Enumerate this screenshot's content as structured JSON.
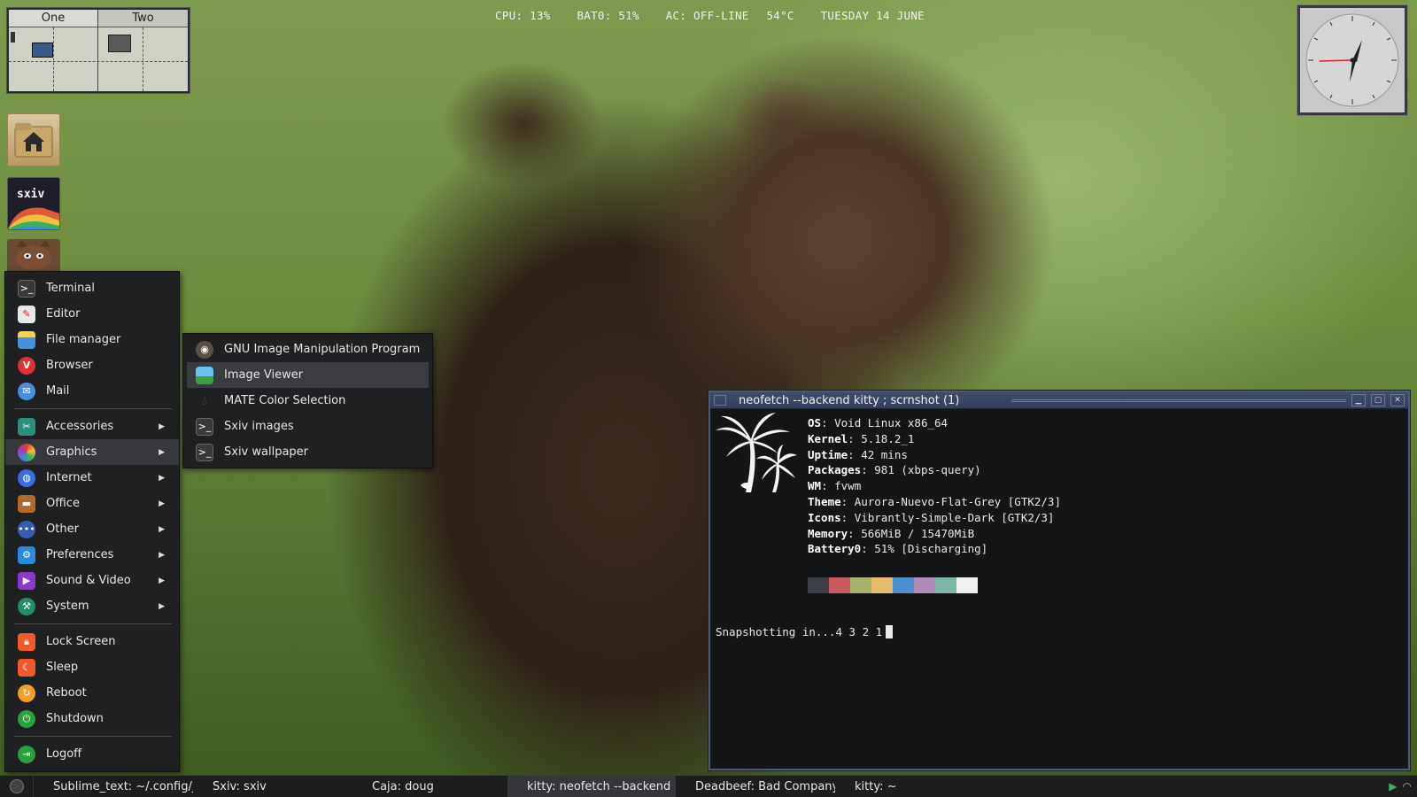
{
  "status_bar": {
    "cpu": "CPU: 13%",
    "battery": "BAT0: 51%",
    "ac": "AC: OFF-LINE",
    "temp": "54°C",
    "date": "TUESDAY 14 JUNE"
  },
  "pager": {
    "desks": [
      "One",
      "Two"
    ]
  },
  "desktop_icons": [
    {
      "name": "home-folder-icon"
    },
    {
      "name": "sxiv-icon"
    },
    {
      "name": "cat-icon"
    }
  ],
  "menu": {
    "items": [
      {
        "label": "Terminal",
        "icon": "terminal-icon",
        "color": "#3a3a3a"
      },
      {
        "label": "Editor",
        "icon": "editor-icon",
        "color": "#d8d8d8"
      },
      {
        "label": "File manager",
        "icon": "file-manager-icon",
        "color": "#4a90d9"
      },
      {
        "label": "Browser",
        "icon": "browser-icon",
        "color": "#e0303a"
      },
      {
        "label": "Mail",
        "icon": "mail-icon",
        "color": "#4a8ee0"
      }
    ],
    "categories": [
      {
        "label": "Accessories",
        "icon": "accessories-icon",
        "color": "#2f8f7f"
      },
      {
        "label": "Graphics",
        "icon": "graphics-icon",
        "color": "#e07a3a"
      },
      {
        "label": "Internet",
        "icon": "internet-icon",
        "color": "#3a6ee0"
      },
      {
        "label": "Office",
        "icon": "office-icon",
        "color": "#b06a30"
      },
      {
        "label": "Other",
        "icon": "other-icon",
        "color": "#3a5ab0"
      },
      {
        "label": "Preferences",
        "icon": "preferences-icon",
        "color": "#2a8ae0"
      },
      {
        "label": "Sound & Video",
        "icon": "sound-video-icon",
        "color": "#8a3ac0"
      },
      {
        "label": "System",
        "icon": "system-icon",
        "color": "#2a8a6a"
      }
    ],
    "session": [
      {
        "label": "Lock Screen",
        "icon": "lock-icon",
        "color": "#f05a2a"
      },
      {
        "label": "Sleep",
        "icon": "sleep-icon",
        "color": "#f05a2a"
      },
      {
        "label": "Reboot",
        "icon": "reboot-icon",
        "color": "#f0a02a"
      },
      {
        "label": "Shutdown",
        "icon": "shutdown-icon",
        "color": "#2aa040"
      }
    ],
    "logoff": {
      "label": "Logoff",
      "icon": "logoff-icon",
      "color": "#2aa040"
    }
  },
  "submenu": {
    "items": [
      {
        "label": "GNU Image Manipulation Program",
        "icon": "gimp-icon"
      },
      {
        "label": "Image Viewer",
        "icon": "image-viewer-icon"
      },
      {
        "label": "MATE Color Selection",
        "icon": "color-selection-icon"
      },
      {
        "label": "Sxiv images",
        "icon": "terminal-icon"
      },
      {
        "label": "Sxiv wallpaper",
        "icon": "terminal-icon"
      }
    ]
  },
  "terminal": {
    "title": "neofetch --backend kitty ; scrnshot (1)",
    "info": [
      {
        "key": "OS",
        "value": ": Void Linux x86_64"
      },
      {
        "key": "Kernel",
        "value": ": 5.18.2_1"
      },
      {
        "key": "Uptime",
        "value": ": 42 mins"
      },
      {
        "key": "Packages",
        "value": ": 981 (xbps-query)"
      },
      {
        "key": "WM",
        "value": ": fvwm"
      },
      {
        "key": "Theme",
        "value": ": Aurora-Nuevo-Flat-Grey [GTK2/3]"
      },
      {
        "key": "Icons",
        "value": ": Vibrantly-Simple-Dark [GTK2/3]"
      },
      {
        "key": "Memory",
        "value": ": 566MiB / 15470MiB"
      },
      {
        "key": "Battery0",
        "value": ": 51% [Discharging]"
      }
    ],
    "swatches": [
      "#3b3e45",
      "#c95a5e",
      "#a7b36a",
      "#e6bd6a",
      "#4d8fce",
      "#b48ab6",
      "#7fb7a8",
      "#f0f0f0"
    ],
    "snapshot": "Snapshotting in...4 3 2 1"
  },
  "taskbar": {
    "tasks": [
      "Sublime_text: ~/.config/jg",
      "Sxiv: sxiv",
      "Caja: doug",
      "kitty: neofetch --backend",
      "Deadbeef: Bad Company -",
      "kitty: ~"
    ]
  }
}
